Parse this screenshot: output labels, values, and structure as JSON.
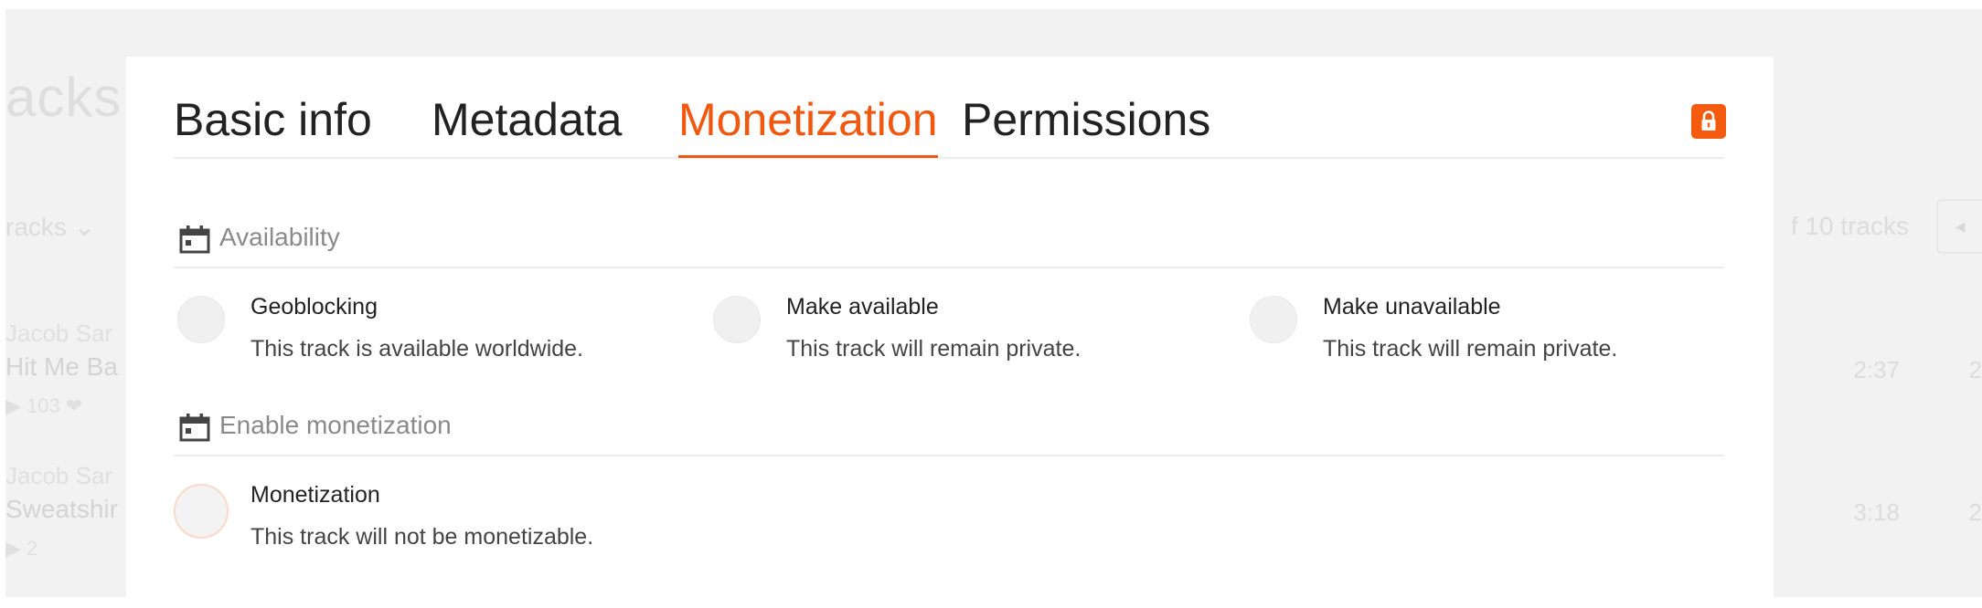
{
  "background": {
    "page_title": "acks",
    "filter_label": "racks ⌄",
    "track_count": "f 10 tracks",
    "rows": [
      {
        "artist": "Jacob Sar",
        "title": "Hit Me Ba",
        "stats": "▶ 103  ❤",
        "duration": "2:37",
        "extra": "2"
      },
      {
        "artist": "Jacob Sar",
        "title": "Sweatshir",
        "stats": "▶ 2",
        "duration": "3:18",
        "extra": "2"
      }
    ]
  },
  "modal": {
    "tabs": [
      {
        "label": "Basic info"
      },
      {
        "label": "Metadata"
      },
      {
        "label": "Monetization",
        "active": true
      },
      {
        "label": "Permissions"
      }
    ],
    "lock_icon": "lock-icon",
    "sections": [
      {
        "label": "Availability",
        "icon": "calendar-icon",
        "options": [
          {
            "title": "Geoblocking",
            "description": "This track is available worldwide."
          },
          {
            "title": "Make available",
            "description": "This track will remain private."
          },
          {
            "title": "Make unavailable",
            "description": "This track will remain private."
          }
        ]
      },
      {
        "label": "Enable monetization",
        "icon": "calendar-icon",
        "options": [
          {
            "title": "Monetization",
            "description": "This track will not be monetizable."
          }
        ]
      }
    ]
  },
  "colors": {
    "accent": "#f2570f",
    "lock_button": "#f55b0f",
    "overlay_bg": "#f2f2f2"
  }
}
